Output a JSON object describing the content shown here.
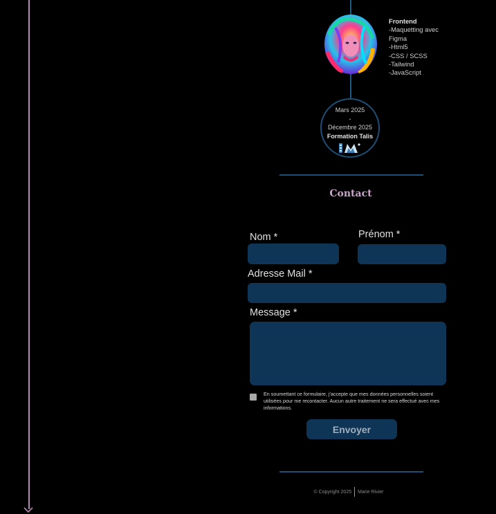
{
  "skills": {
    "title": "Frontend",
    "items": [
      "-Maquetting avec",
      "Figma",
      "-Html5",
      "-CSS / SCSS",
      "-Tailwind",
      "-JavaScript"
    ]
  },
  "education": {
    "start": "Mars 2025",
    "dash": "-",
    "end": "Décembre 2025",
    "school": "Formation Talis"
  },
  "contact": {
    "title": "Contact",
    "nom_label": "Nom *",
    "prenom_label": "Prénom *",
    "email_label": "Adresse Mail *",
    "message_label": "Message *",
    "consent_text": "En soumettant ce formulaire, j'accepte que mes données personnelles soient utilisées pour me recontacter. Aucun autre traitement ne sera effectué avec mes informations.",
    "submit_label": "Envoyer"
  },
  "footer": {
    "copyright": "© Copyright 2025",
    "author": "Marie Rivier"
  },
  "colors": {
    "background": "#000000",
    "accent_blue": "#0e3556",
    "timeline_blue": "#1d5a86",
    "title_mauve": "#c9a3c9"
  }
}
